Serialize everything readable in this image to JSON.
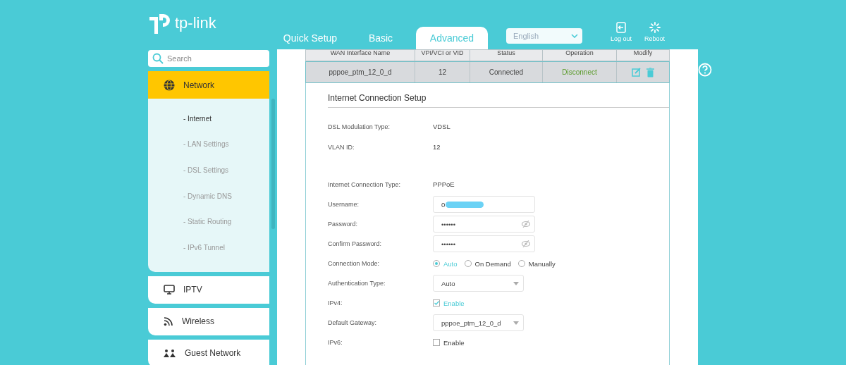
{
  "brand": {
    "name": "tp-link"
  },
  "nav_tabs": [
    {
      "label": "Quick Setup",
      "selected": false
    },
    {
      "label": "Basic",
      "selected": false
    },
    {
      "label": "Advanced",
      "selected": true
    }
  ],
  "language": {
    "value": "English"
  },
  "header_actions": [
    {
      "kind": "logout",
      "label": "Log out"
    },
    {
      "kind": "reboot",
      "label": "Reboot"
    }
  ],
  "sidebar": {
    "search": {
      "placeholder": "Search"
    },
    "items": [
      {
        "kind": "network",
        "label": "Network",
        "selected": true,
        "expanded": true,
        "children": [
          {
            "label": "- Internet",
            "selected": true
          },
          {
            "label": "- LAN Settings",
            "selected": false
          },
          {
            "label": "- DSL Settings",
            "selected": false
          },
          {
            "label": "- Dynamic DNS",
            "selected": false
          },
          {
            "label": "- Static Routing",
            "selected": false
          },
          {
            "label": "- IPv6 Tunnel",
            "selected": false
          }
        ]
      },
      {
        "kind": "iptv",
        "label": "IPTV",
        "selected": false,
        "expanded": false
      },
      {
        "kind": "wireless",
        "label": "Wireless",
        "selected": false,
        "expanded": false
      },
      {
        "kind": "guest",
        "label": "Guest Network",
        "selected": false,
        "expanded": false
      }
    ]
  },
  "wan_table": {
    "columns": [
      "WAN Interface Name",
      "VPI/VCI or VID",
      "Status",
      "Operation",
      "Modify"
    ],
    "rows": [
      {
        "name": "pppoe_ptm_12_0_d",
        "vid": "12",
        "status": "Connected",
        "operation": "Disconnect"
      }
    ]
  },
  "form": {
    "title": "Internet Connection Setup",
    "fields": [
      {
        "kind": "text",
        "label": "DSL Modulation Type:",
        "value": "VDSL"
      },
      {
        "kind": "text",
        "label": "VLAN ID:",
        "value": "12"
      },
      {
        "kind": "spacer"
      },
      {
        "kind": "text",
        "label": "Internet Connection Type:",
        "value": "PPPoE"
      },
      {
        "kind": "input",
        "label": "Username:",
        "value": "0",
        "redacted": true
      },
      {
        "kind": "password",
        "label": "Password:",
        "value": "••••••"
      },
      {
        "kind": "password",
        "label": "Confirm Password:",
        "value": "••••••"
      },
      {
        "kind": "radio",
        "label": "Connection Mode:",
        "options": [
          {
            "label": "Auto",
            "selected": true
          },
          {
            "label": "On Demand",
            "selected": false
          },
          {
            "label": "Manually",
            "selected": false
          }
        ]
      },
      {
        "kind": "select",
        "label": "Authentication Type:",
        "value": "Auto"
      },
      {
        "kind": "checkbox",
        "label": "IPv4:",
        "option": "Enable",
        "checked": true
      },
      {
        "kind": "select",
        "label": "Default Gateway:",
        "value": "pppoe_ptm_12_0_d"
      },
      {
        "kind": "checkbox",
        "label": "IPv6:",
        "option": "Enable",
        "checked": false
      }
    ]
  }
}
